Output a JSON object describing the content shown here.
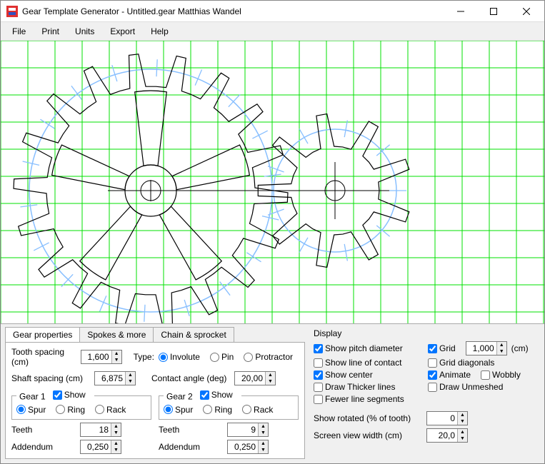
{
  "window": {
    "title": "Gear Template Generator - Untitled.gear    Matthias Wandel"
  },
  "menu": {
    "file": "File",
    "print": "Print",
    "units": "Units",
    "export": "Export",
    "help": "Help"
  },
  "tabs": {
    "gear_properties": "Gear properties",
    "spokes": "Spokes & more",
    "chain": "Chain & sprocket"
  },
  "tooth_spacing": {
    "label": "Tooth spacing (cm)",
    "value": "1,600"
  },
  "type": {
    "label": "Type:",
    "involute": "Involute",
    "pin": "Pin",
    "protractor": "Protractor"
  },
  "shaft_spacing": {
    "label": "Shaft spacing (cm)",
    "value": "6,875"
  },
  "contact_angle": {
    "label": "Contact angle (deg)",
    "value": "20,00"
  },
  "gear1": {
    "legend": "Gear 1",
    "show": "Show",
    "spur": "Spur",
    "ring": "Ring",
    "rack": "Rack",
    "teeth_label": "Teeth",
    "teeth": "18",
    "addendum_label": "Addendum",
    "addendum": "0,250"
  },
  "gear2": {
    "legend": "Gear 2",
    "show": "Show",
    "spur": "Spur",
    "ring": "Ring",
    "rack": "Rack",
    "teeth_label": "Teeth",
    "teeth": "9",
    "addendum_label": "Addendum",
    "addendum": "0,250"
  },
  "display": {
    "heading": "Display",
    "pitch": "Show pitch diameter",
    "grid": "Grid",
    "grid_value": "1,000",
    "grid_unit": "(cm)",
    "line_contact": "Show line of contact",
    "grid_diag": "Grid diagonals",
    "center": "Show center",
    "animate": "Animate",
    "wobbly": "Wobbly",
    "thicker": "Draw Thicker lines",
    "unmeshed": "Draw Unmeshed",
    "fewer": "Fewer line segments",
    "rotated_label": "Show rotated (% of tooth)",
    "rotated": "0",
    "view_width_label": "Screen view width (cm)",
    "view_width": "20,0"
  }
}
